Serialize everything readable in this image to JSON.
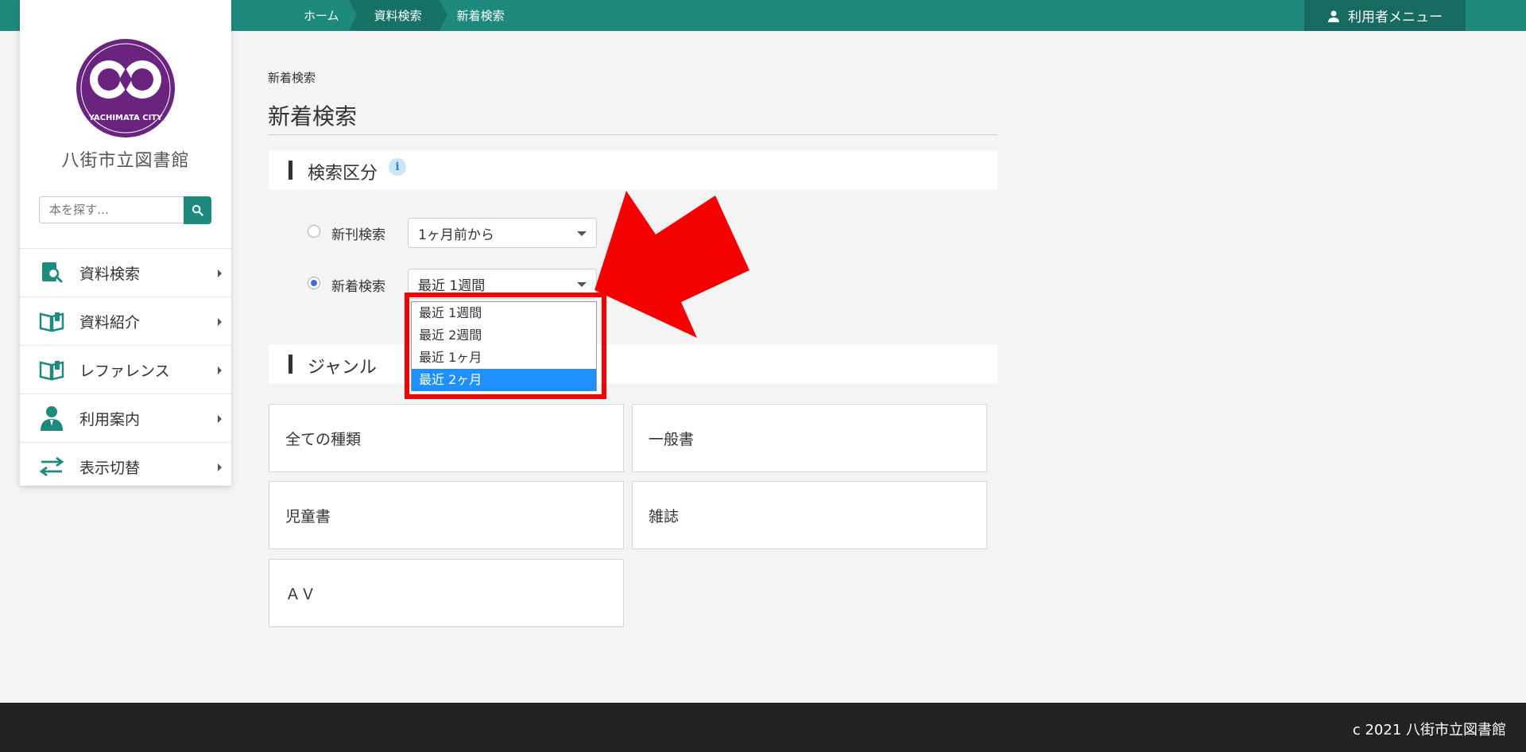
{
  "topbar": {
    "breadcrumbs": [
      "ホーム",
      "資料検索",
      "新着検索"
    ],
    "user_menu": "利用者メニュー"
  },
  "sidebar": {
    "logo_text": "YACHIMATA CITY",
    "library_name": "八街市立図書館",
    "search_placeholder": "本を探す…",
    "items": [
      {
        "label": "資料検索",
        "icon": "search-book-icon"
      },
      {
        "label": "資料紹介",
        "icon": "open-book-icon"
      },
      {
        "label": "レファレンス",
        "icon": "open-book-icon"
      },
      {
        "label": "利用案内",
        "icon": "person-icon"
      },
      {
        "label": "表示切替",
        "icon": "switch-arrows-icon"
      }
    ]
  },
  "main": {
    "breadcrumb": "新着検索",
    "title": "新着検索",
    "search_section": {
      "title": "検索区分",
      "options": [
        {
          "label": "新刊検索",
          "checked": false,
          "select_value": "1ヶ月前から"
        },
        {
          "label": "新着検索",
          "checked": true,
          "select_value": "最近 1週間"
        }
      ],
      "dropdown_options": [
        "最近 1週間",
        "最近 2週間",
        "最近 1ヶ月",
        "最近 2ヶ月"
      ],
      "highlighted_option": "最近 2ヶ月"
    },
    "genre_section": {
      "title": "ジャンル",
      "genres": [
        "全ての種類",
        "一般書",
        "児童書",
        "雑誌",
        "ＡＶ"
      ]
    }
  },
  "footer": {
    "copyright": "c 2021 八街市立図書館"
  },
  "colors": {
    "brand": "#1e8a7e",
    "annotation_red": "#f50000",
    "selection_blue": "#1e90ff",
    "logo_purple": "#6a2480"
  }
}
